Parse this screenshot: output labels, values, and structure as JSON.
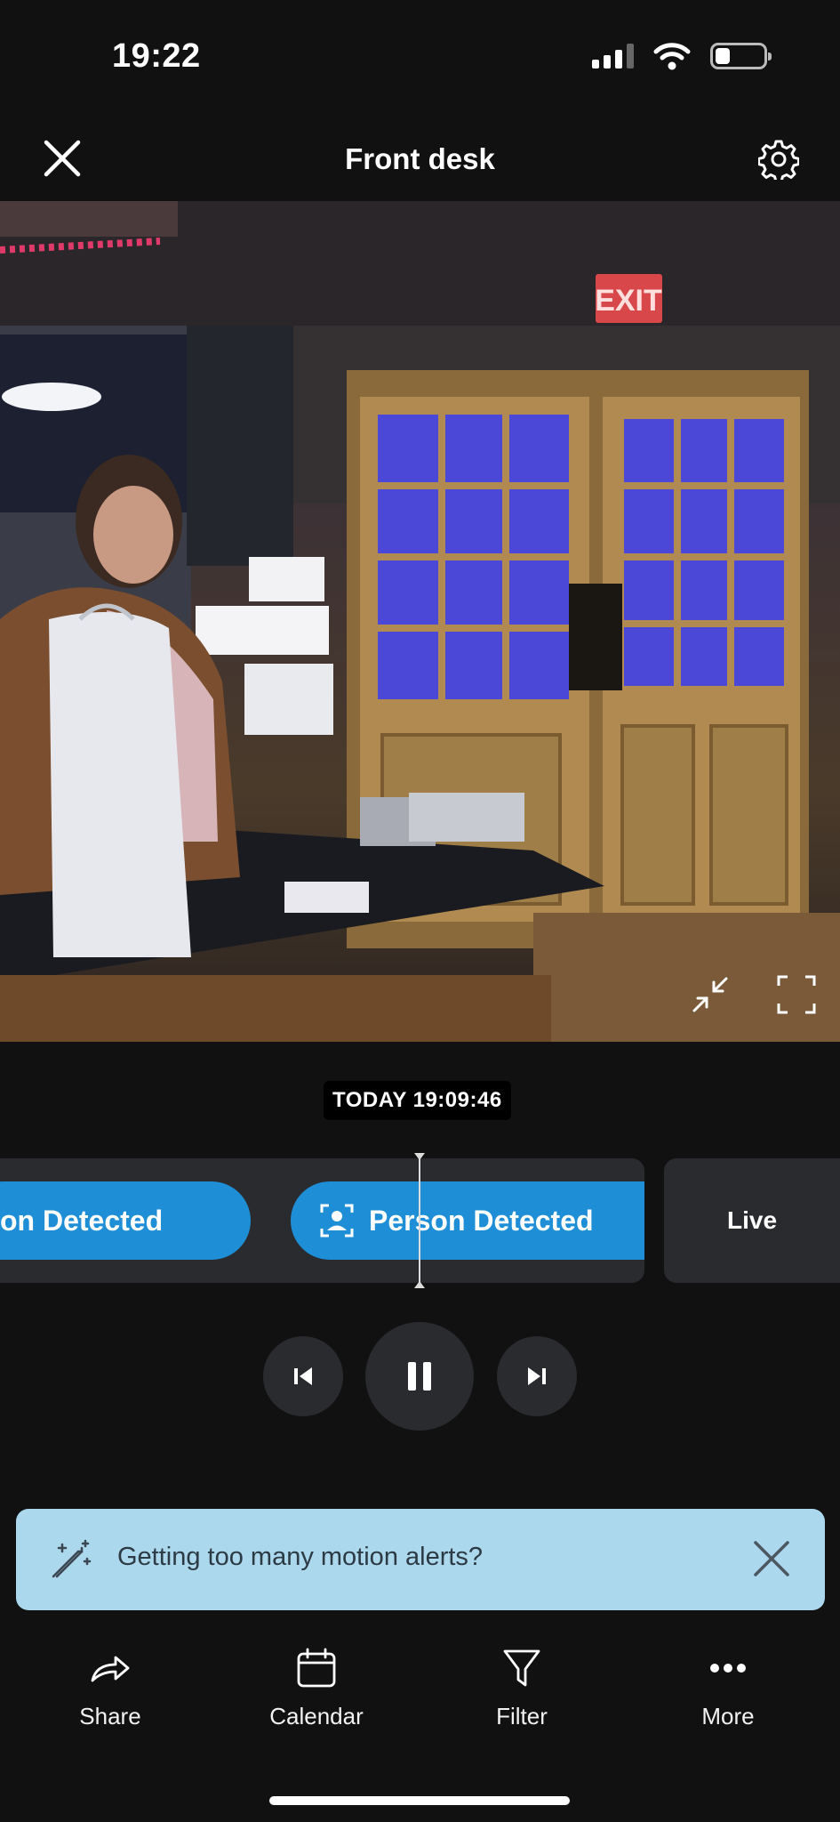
{
  "status_bar": {
    "time": "19:22"
  },
  "header": {
    "title": "Front desk",
    "close_icon": "close-icon",
    "settings_icon": "gear-icon"
  },
  "video": {
    "exit_sign": "EXIT",
    "controls": {
      "minimize_icon": "collapse-icon",
      "fullscreen_icon": "fullscreen-icon"
    }
  },
  "timeline": {
    "timestamp": "TODAY 19:09:46",
    "events": [
      {
        "label": "on Detected",
        "type": "person"
      },
      {
        "label": "Person Detected",
        "type": "person",
        "icon": "person-icon"
      }
    ],
    "live_label": "Live"
  },
  "playback": {
    "prev_icon": "skip-back-icon",
    "pause_icon": "pause-icon",
    "next_icon": "skip-forward-icon"
  },
  "banner": {
    "text": "Getting too many motion alerts?",
    "icon": "magic-wand-icon"
  },
  "bottom_nav": [
    {
      "label": "Share",
      "icon": "share-icon"
    },
    {
      "label": "Calendar",
      "icon": "calendar-icon"
    },
    {
      "label": "Filter",
      "icon": "filter-icon"
    },
    {
      "label": "More",
      "icon": "more-icon"
    }
  ],
  "colors": {
    "accent": "#1e8fd6",
    "banner": "#acd8ee",
    "background": "#111112",
    "surface": "#2a2b2e"
  }
}
